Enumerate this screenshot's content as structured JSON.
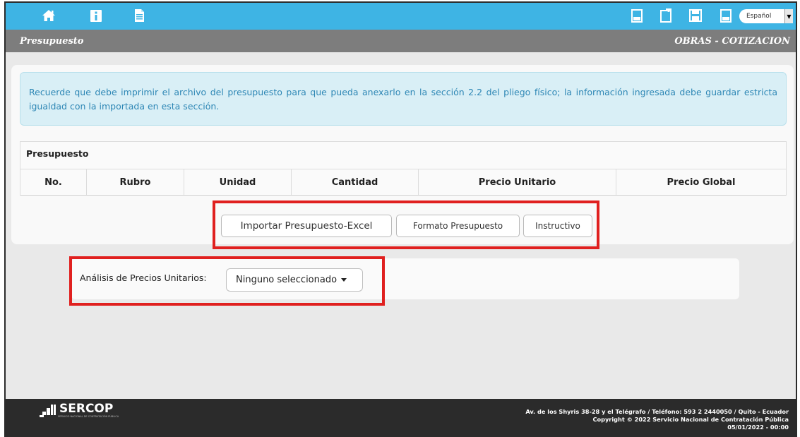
{
  "topbar": {
    "icons_left": [
      "home-icon",
      "info-icon",
      "document-icon"
    ],
    "icons_right": [
      "pdf-icon",
      "file-icon",
      "save-icon",
      "pdf-icon"
    ],
    "language": "Español",
    "color": "#3eb4e4"
  },
  "header": {
    "left": "Presupuesto",
    "right": "OBRAS - COTIZACION"
  },
  "alert": {
    "text": "Recuerde que debe imprimir el archivo del presupuesto para que pueda anexarlo en la sección 2.2 del pliego físico; la información ingresada debe guardar estricta igualdad con la importada en esta sección."
  },
  "budget_table": {
    "title": "Presupuesto",
    "columns": [
      "No.",
      "Rubro",
      "Unidad",
      "Cantidad",
      "Precio Unitario",
      "Precio Global"
    ]
  },
  "actions": {
    "import_label": "Importar Presupuesto-Excel",
    "format_label": "Formato Presupuesto",
    "instructions_label": "Instructivo"
  },
  "analysis": {
    "label": "Análisis de Precios Unitarios:",
    "selected": "Ninguno seleccionado"
  },
  "footer": {
    "logo_text": "SERCOP",
    "logo_tagline": "SERVICIO NACIONAL DE CONTRATACIÓN PÚBLICA",
    "address": "Av. de los Shyris 38-28 y el Telégrafo / Teléfono: 593 2 2440050 / Quito - Ecuador",
    "copyright": "Copyright © 2022 Servicio Nacional de Contratación Pública",
    "datetime": "05/01/2022 - 00:00"
  },
  "highlight_color": "#e0201f"
}
